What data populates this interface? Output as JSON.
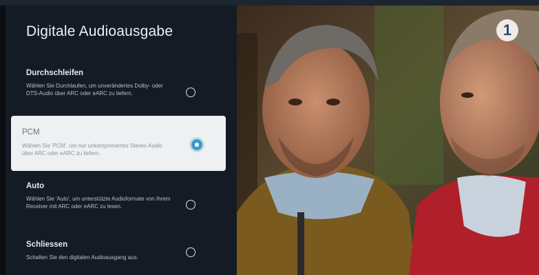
{
  "panel": {
    "title": "Digitale Audioausgabe",
    "options": [
      {
        "title": "Durchschleifen",
        "description": "Wählen Sie Durchlaufen, um unverändertes Dolby- oder DTS-Audio über ARC oder eARC zu liefern.",
        "selected": false
      },
      {
        "title": "PCM",
        "description": "Wählen Sie 'PCM', um nur unkomprimiertes Stereo-Audio über ARC oder eARC zu liefern.",
        "selected": true
      },
      {
        "title": "Auto",
        "description": "Wählen Sie 'Auto', um unterstützte Audioformate von Ihrem Receiver mit ARC oder eARC zu lesen.",
        "selected": false
      },
      {
        "title": "Schliessen",
        "description": "Schalten Sie den digitalen Audioausgang aus.",
        "selected": false
      }
    ]
  },
  "video": {
    "channel_logo": "1"
  }
}
